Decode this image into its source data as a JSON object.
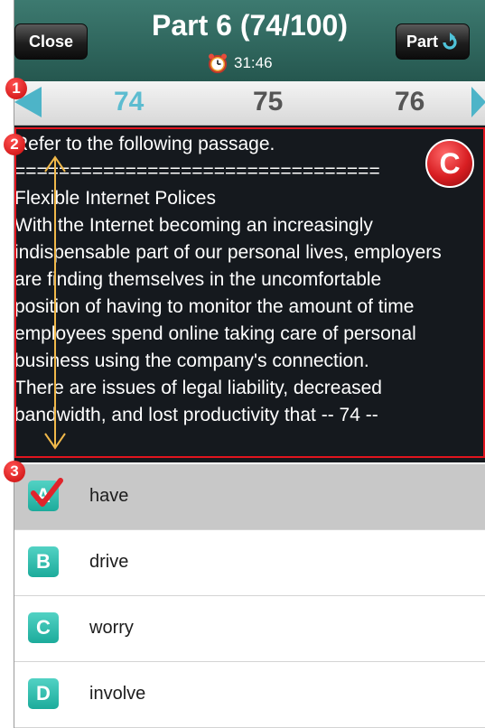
{
  "header": {
    "close_label": "Close",
    "title": "Part 6 (74/100)",
    "timer": "31:46",
    "part_label": "Part",
    "icons": {
      "timer": "alarm-clock-icon",
      "part": "refresh-arrow-icon"
    }
  },
  "page_nav": {
    "numbers": [
      "74",
      "75",
      "76"
    ],
    "current": "74"
  },
  "passage": {
    "lines": [
      "Refer to the following passage.",
      "=================================",
      "Flexible Internet Polices",
      "",
      "With the Internet becoming an increasingly",
      "indispensable part of our personal lives, employers",
      "are finding themselves in the uncomfortable",
      "position of having to monitor the amount of time",
      "employees spend online taking care of personal",
      "business using the company's connection.",
      "",
      "There are issues of legal liability, decreased",
      "bandwidth, and lost productivity that -- 74 --"
    ],
    "badge": "C"
  },
  "markers": [
    "1",
    "2",
    "3"
  ],
  "choices": [
    {
      "letter": "A",
      "text": "have",
      "selected": true
    },
    {
      "letter": "B",
      "text": "drive",
      "selected": false
    },
    {
      "letter": "C",
      "text": "worry",
      "selected": false
    },
    {
      "letter": "D",
      "text": "involve",
      "selected": false
    }
  ],
  "colors": {
    "header": "#2f6a61",
    "accent": "#4db4c8",
    "choice_badge": "#25b5a5",
    "highlight_red": "#e2141e"
  }
}
